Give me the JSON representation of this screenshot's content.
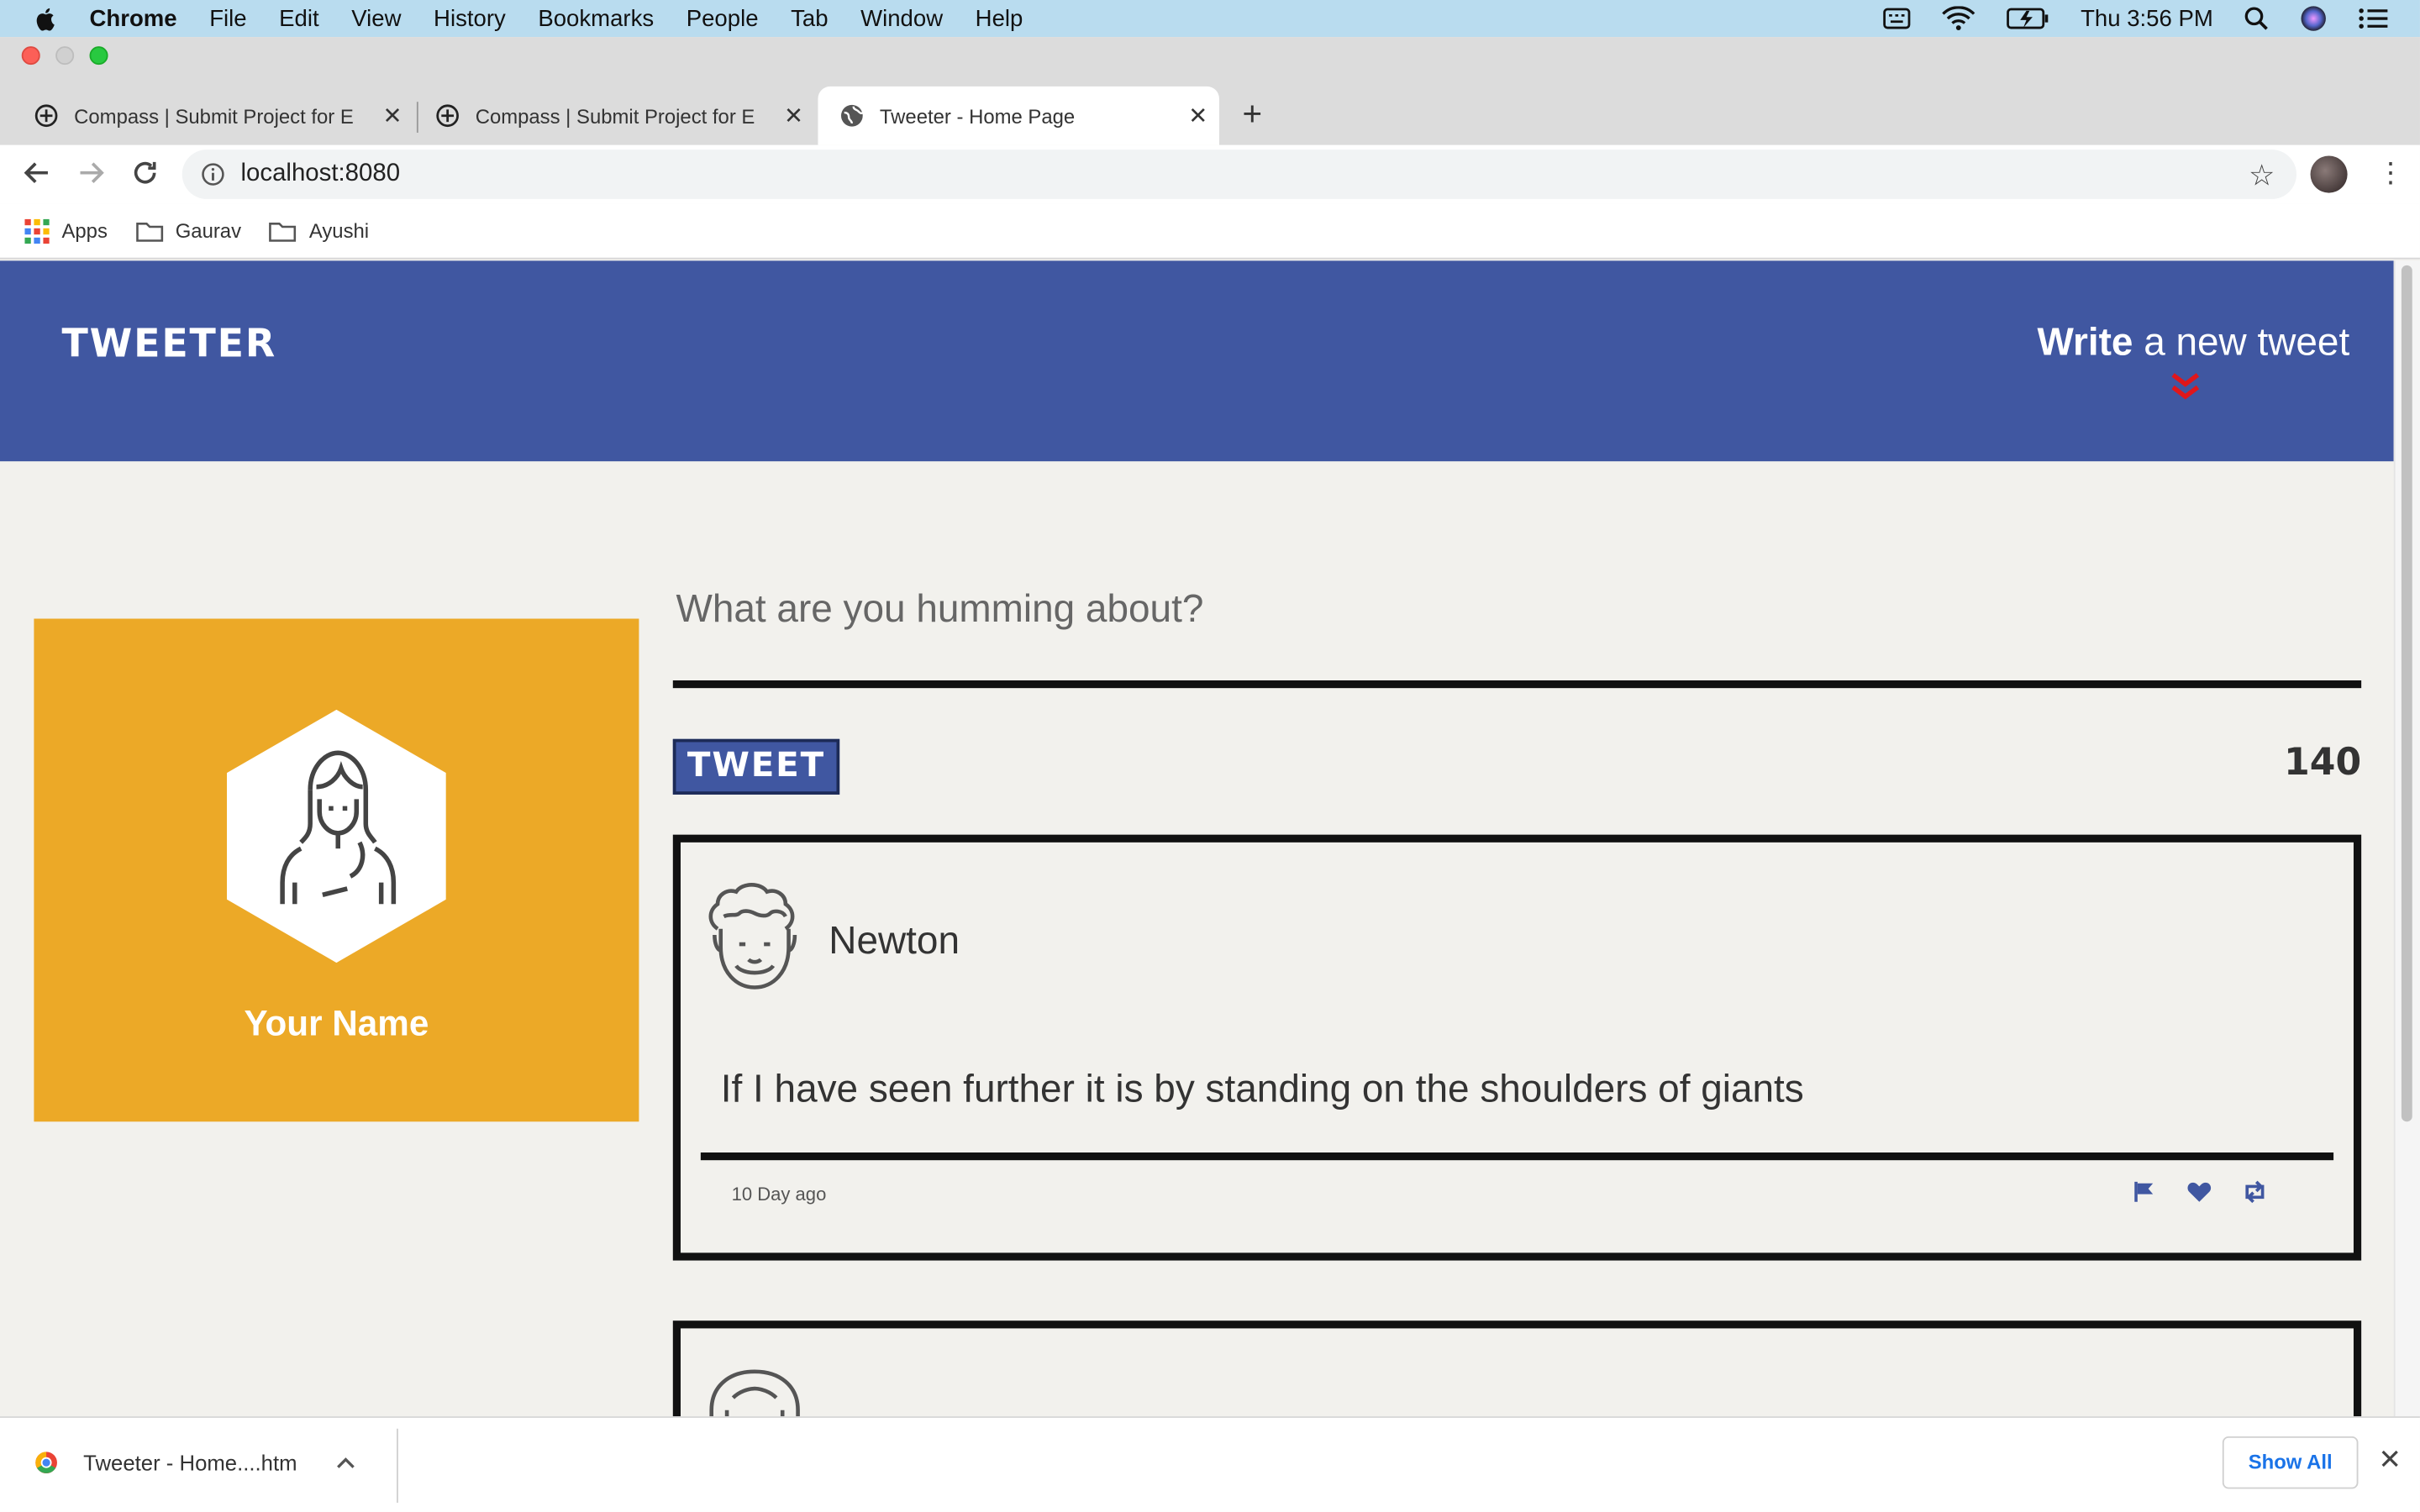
{
  "menubar": {
    "app": "Chrome",
    "items": [
      "File",
      "Edit",
      "View",
      "History",
      "Bookmarks",
      "People",
      "Tab",
      "Window",
      "Help"
    ],
    "clock": "Thu 3:56 PM"
  },
  "tabs": [
    {
      "title": "Compass | Submit Project for E",
      "active": false
    },
    {
      "title": "Compass | Submit Project for E",
      "active": false
    },
    {
      "title": "Tweeter - Home Page",
      "active": true
    }
  ],
  "address": {
    "url": "localhost:8080"
  },
  "bookmarks": [
    "Apps",
    "Gaurav",
    "Ayushi"
  ],
  "page": {
    "logo": "TWEETER",
    "write_bold": "Write",
    "write_rest": " a new tweet",
    "profile_name": "Your Name",
    "compose_placeholder": "What are you humming about?",
    "tweet_button": "TWEET",
    "counter": "140",
    "tweets": [
      {
        "user": "Newton",
        "text": "If I have seen further it is by standing on the shoulders of giants",
        "age": "10 Day ago"
      }
    ]
  },
  "download": {
    "file": "Tweeter - Home....htm",
    "show_all": "Show All"
  },
  "colors": {
    "header": "#4057a1",
    "profile_bg": "#eca927",
    "accent_red": "#e0161b",
    "page_bg": "#f2f1ed"
  }
}
